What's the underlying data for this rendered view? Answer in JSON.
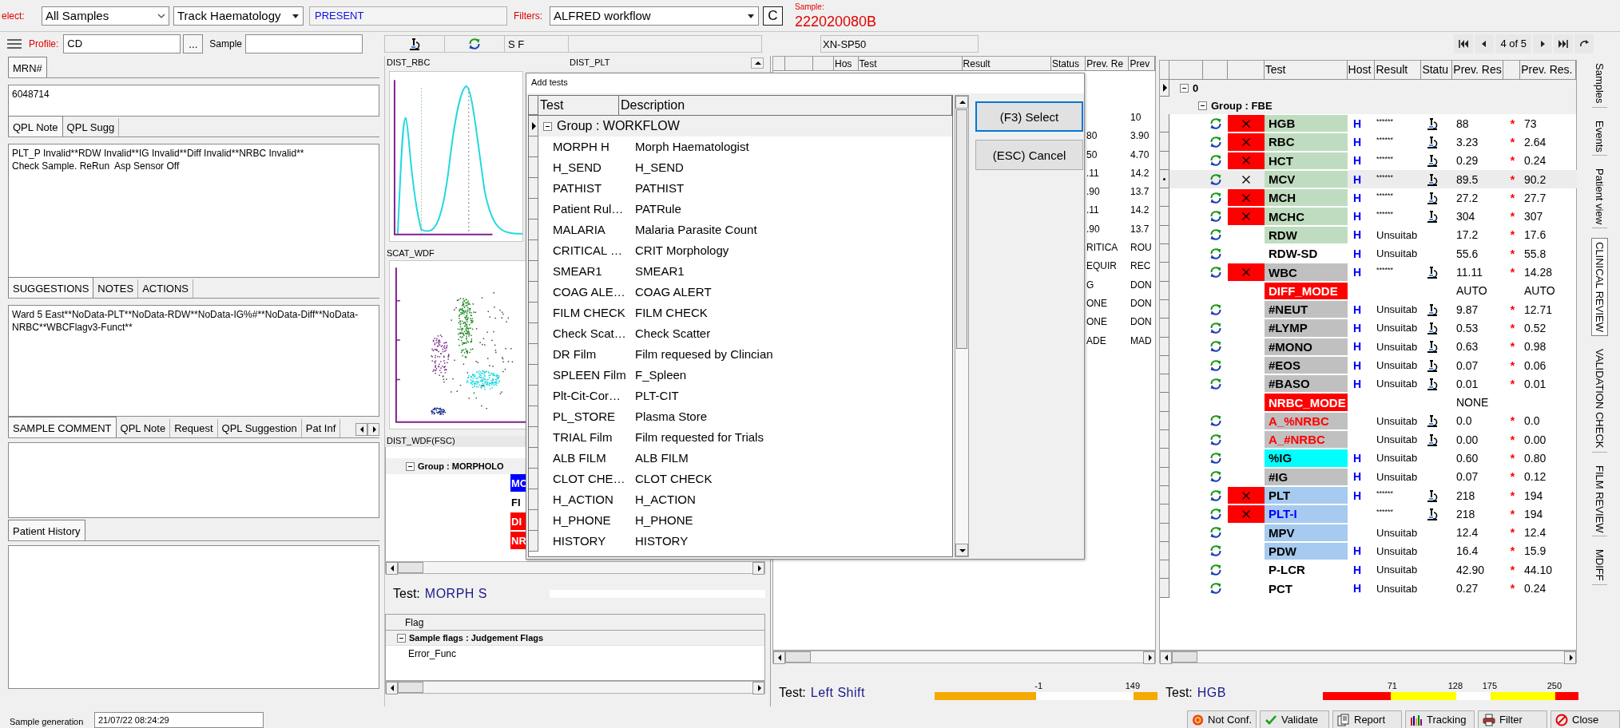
{
  "toolbar": {
    "select_label": "elect:",
    "sample_filter": "All Samples",
    "track": "Track Haematology",
    "status": "PRESENT",
    "filters_label": "Filters:",
    "workflow": "ALFRED workflow",
    "clear_button": "C",
    "sample_label": "Sample:",
    "sample_id": "222020080B"
  },
  "profile_bar": {
    "profile_label": "Profile:",
    "profile": "CD",
    "browse_button": "...",
    "sample_label": "Sample"
  },
  "instrument_bar": {
    "flags": "S F",
    "analyzer": "XN-SP50"
  },
  "navigator": {
    "position": "4 of 5"
  },
  "left_panel": {
    "mrn_tabs": [
      {
        "label": "MRN#",
        "selected": true
      }
    ],
    "mrn": "6048714",
    "note_tabs": [
      {
        "label": "QPL Note",
        "selected": true
      },
      {
        "label": "QPL Sugg",
        "selected": false
      }
    ],
    "note": "PLT_P Invalid**RDW Invalid**IG Invalid**Diff Invalid**NRBC Invalid**\nCheck Sample. ReRun  Asp Sensor Off",
    "suggestion_tabs": [
      {
        "label": "SUGGESTIONS",
        "selected": true
      },
      {
        "label": "NOTES",
        "selected": false
      },
      {
        "label": "ACTIONS",
        "selected": false
      }
    ],
    "suggestions": "Ward 5 East**NoData-PLT**NoData-RDW**NoData-IG%#**NoData-Diff**NoData-NRBC**WBCFlagv3-Funct**",
    "comment_tabs": [
      {
        "label": "SAMPLE COMMENT",
        "selected": true
      },
      {
        "label": "QPL Note",
        "selected": false
      },
      {
        "label": "Request",
        "selected": false
      },
      {
        "label": "QPL Suggestion",
        "selected": false
      },
      {
        "label": "Pat Inf",
        "selected": false
      }
    ],
    "history_tabs": [
      {
        "label": "Patient History",
        "selected": true
      }
    ],
    "sample_generation_label": "Sample generation",
    "sample_generation": "21/07/22 08:24:29"
  },
  "graphs": {
    "rbc_title": "DIST_RBC",
    "plt_title": "DIST_PLT",
    "wdf_title": "SCAT_WDF",
    "fsc_title": "DIST_WDF(FSC)"
  },
  "morphology_grid": {
    "group": "Group : MORPHOLO",
    "cells": [
      {
        "text": "MO",
        "color": "#0000ff"
      },
      {
        "text": "FI",
        "color": "#ffffff"
      },
      {
        "text": "DI",
        "color": "#ff0000"
      },
      {
        "text": "NR",
        "color": "#ff0000"
      }
    ]
  },
  "morph_test": {
    "label": "Test:",
    "name": "MORPH S"
  },
  "flag_grid": {
    "header": "Flag",
    "group": "Sample flags : Judgement Flags",
    "rows": [
      "Error_Func"
    ]
  },
  "results_grid": {
    "columns": [
      "Hos",
      "Test",
      "Result",
      "Status",
      "Prev. Re",
      "Prev"
    ],
    "rows": [
      {
        "prev_2": "10"
      },
      {
        "prev_1": "80",
        "prev_2": "3.90"
      },
      {
        "prev_1": "50",
        "prev_2": "4.70"
      },
      {
        "prev_1": ".11",
        "prev_2": "14.2"
      },
      {
        "prev_1": ".90",
        "prev_2": "13.7"
      },
      {
        "prev_1": ".11",
        "prev_2": "14.2"
      },
      {
        "prev_1": ".90",
        "prev_2": "13.7"
      },
      {
        "prev_1": "RITICA",
        "prev_2": "ROU"
      },
      {
        "prev_1": "EQUIR",
        "prev_2": "REC"
      },
      {
        "prev_1": "G",
        "prev_2": "DON"
      },
      {
        "prev_1": "ONE",
        "prev_2": "DON"
      },
      {
        "prev_1": "ONE",
        "prev_2": "DON"
      },
      {
        "prev_1": "ADE",
        "prev_2": "MAD"
      }
    ]
  },
  "left_shift": {
    "label": "Test:",
    "name": "Left Shift",
    "segments": [
      {
        "color": "#f4aa00",
        "tick": "-1"
      },
      {
        "color": "#ffffff",
        "tick": "149"
      },
      {
        "color": "#f4aa00"
      }
    ]
  },
  "dialog": {
    "title": "Add tests",
    "columns": [
      "Test",
      "Description"
    ],
    "group": "Group : WORKFLOW",
    "rows": [
      {
        "test": "MORPH H",
        "description": "Morph Haematologist"
      },
      {
        "test": "H_SEND",
        "description": "H_SEND"
      },
      {
        "test": "PATHIST",
        "description": "PATHIST"
      },
      {
        "test": "Patient Rul…",
        "description": "PATRule"
      },
      {
        "test": "MALARIA",
        "description": "Malaria Parasite Count"
      },
      {
        "test": "CRITICAL …",
        "description": "CRIT Morphology"
      },
      {
        "test": "SMEAR1",
        "description": "SMEAR1"
      },
      {
        "test": "COAG ALE…",
        "description": "COAG ALERT"
      },
      {
        "test": "FILM CHECK",
        "description": "FILM CHECK"
      },
      {
        "test": "Check Scat…",
        "description": "Check Scatter"
      },
      {
        "test": "DR Film",
        "description": "Film requesed by Clincian"
      },
      {
        "test": "SPLEEN Film",
        "description": "F_Spleen"
      },
      {
        "test": "Plt-Cit-Cor…",
        "description": "PLT-CIT"
      },
      {
        "test": "PL_STORE",
        "description": "Plasma Store"
      },
      {
        "test": "TRIAL Film",
        "description": "Film requested for Trials"
      },
      {
        "test": "ALB FILM",
        "description": "ALB FILM"
      },
      {
        "test": "CLOT CHE…",
        "description": "CLOT CHECK"
      },
      {
        "test": "H_ACTION",
        "description": "H_ACTION"
      },
      {
        "test": "H_PHONE",
        "description": "H_PHONE"
      },
      {
        "test": "HISTORY",
        "description": "HISTORY"
      }
    ],
    "buttons": [
      {
        "label": "(F3) Select",
        "default": true
      },
      {
        "label": "(ESC) Cancel",
        "default": false
      }
    ]
  },
  "review_grid": {
    "columns": [
      "Test",
      "Host",
      "Result",
      "Statu",
      "Prev. Res",
      "Prev. Res."
    ],
    "root": "0",
    "group": "Group : FBE",
    "rows": [
      {
        "test": "HGB",
        "kind": "normal",
        "color": "#c0dcc0",
        "refresh": true,
        "flagged": true,
        "host": "H",
        "result": "******",
        "status_icon": true,
        "prev_res": "88",
        "marker": "*",
        "prev_res_2": "73",
        "selected": false
      },
      {
        "test": "RBC",
        "kind": "normal",
        "color": "#c0dcc0",
        "refresh": true,
        "flagged": true,
        "host": "H",
        "result": "******",
        "status_icon": true,
        "prev_res": "3.23",
        "marker": "*",
        "prev_res_2": "2.64",
        "selected": false
      },
      {
        "test": "HCT",
        "kind": "normal",
        "color": "#c0dcc0",
        "refresh": true,
        "flagged": true,
        "host": "H",
        "result": "******",
        "status_icon": true,
        "prev_res": "0.29",
        "marker": "*",
        "prev_res_2": "0.24",
        "selected": false
      },
      {
        "test": "MCV",
        "kind": "normal",
        "color": "#c0dcc0",
        "refresh": true,
        "flagged": true,
        "host": "H",
        "result": "******",
        "status_icon": true,
        "prev_res": "89.5",
        "marker": "*",
        "prev_res_2": "90.2",
        "selected": true
      },
      {
        "test": "MCH",
        "kind": "normal",
        "color": "#c0dcc0",
        "refresh": true,
        "flagged": true,
        "host": "H",
        "result": "******",
        "status_icon": true,
        "prev_res": "27.2",
        "marker": "*",
        "prev_res_2": "27.7",
        "selected": false
      },
      {
        "test": "MCHC",
        "kind": "normal",
        "color": "#c0dcc0",
        "refresh": true,
        "flagged": true,
        "host": "H",
        "result": "******",
        "status_icon": true,
        "prev_res": "304",
        "marker": "*",
        "prev_res_2": "307",
        "selected": false
      },
      {
        "test": "RDW",
        "kind": "normal",
        "color": "#c0dcc0",
        "refresh": true,
        "flagged": false,
        "host": "H",
        "result": "Unsuitab",
        "status_icon": false,
        "prev_res": "17.2",
        "marker": "*",
        "prev_res_2": "17.6",
        "selected": false
      },
      {
        "test": "RDW-SD",
        "kind": "normal",
        "refresh": true,
        "flagged": false,
        "host": "H",
        "result": "Unsuitab",
        "status_icon": false,
        "prev_res": "55.6",
        "marker": "*",
        "prev_res_2": "55.8",
        "selected": false
      },
      {
        "test": "WBC",
        "kind": "normal",
        "color": "#c0c0c0",
        "refresh": true,
        "flagged": true,
        "host": "H",
        "result": "******",
        "status_icon": true,
        "prev_res": "11.11",
        "marker": "*",
        "prev_res_2": "14.28",
        "selected": false
      },
      {
        "test": "DIFF_MODE",
        "kind": "mode",
        "color": "#ff0000",
        "refresh": false,
        "flagged": false,
        "status_icon": false,
        "prev_res": "AUTO",
        "prev_res_2": "AUTO",
        "selected": false
      },
      {
        "test": "#NEUT",
        "kind": "normal",
        "color": "#c0c0c0",
        "refresh": true,
        "flagged": false,
        "host": "H",
        "result": "Unsuitab",
        "status_icon": true,
        "prev_res": "9.87",
        "marker": "*",
        "prev_res_2": "12.71",
        "selected": false
      },
      {
        "test": "#LYMP",
        "kind": "normal",
        "color": "#c0c0c0",
        "refresh": true,
        "flagged": false,
        "host": "H",
        "result": "Unsuitab",
        "status_icon": true,
        "prev_res": "0.53",
        "marker": "*",
        "prev_res_2": "0.52",
        "selected": false
      },
      {
        "test": "#MONO",
        "kind": "normal",
        "color": "#c0c0c0",
        "refresh": true,
        "flagged": false,
        "host": "H",
        "result": "Unsuitab",
        "status_icon": true,
        "prev_res": "0.63",
        "marker": "*",
        "prev_res_2": "0.98",
        "selected": false
      },
      {
        "test": "#EOS",
        "kind": "normal",
        "color": "#c0c0c0",
        "refresh": true,
        "flagged": false,
        "host": "H",
        "result": "Unsuitab",
        "status_icon": true,
        "prev_res": "0.07",
        "marker": "*",
        "prev_res_2": "0.06",
        "selected": false
      },
      {
        "test": "#BASO",
        "kind": "normal",
        "color": "#c0c0c0",
        "refresh": true,
        "flagged": false,
        "host": "H",
        "result": "Unsuitab",
        "status_icon": true,
        "prev_res": "0.01",
        "marker": "*",
        "prev_res_2": "0.01",
        "selected": false
      },
      {
        "test": "NRBC_MODE",
        "kind": "mode",
        "color": "#ff0000",
        "refresh": false,
        "flagged": false,
        "status_icon": false,
        "prev_res": "NONE",
        "selected": false
      },
      {
        "test": "A_%NRBC",
        "kind": "alert",
        "color": "#c0c0c0",
        "refresh": true,
        "flagged": false,
        "result": "Unsuitab",
        "status_icon": true,
        "prev_res": "0.0",
        "marker": "*",
        "prev_res_2": "0.0",
        "selected": false
      },
      {
        "test": "A_#NRBC",
        "kind": "alert",
        "color": "#c0c0c0",
        "refresh": true,
        "flagged": false,
        "result": "Unsuitab",
        "status_icon": true,
        "prev_res": "0.00",
        "marker": "*",
        "prev_res_2": "0.00",
        "selected": false
      },
      {
        "test": "%IG",
        "kind": "normal",
        "color": "#00ffff",
        "refresh": true,
        "flagged": false,
        "host": "H",
        "result": "Unsuitab",
        "status_icon": false,
        "prev_res": "0.60",
        "marker": "*",
        "prev_res_2": "0.80",
        "selected": false
      },
      {
        "test": "#IG",
        "kind": "normal",
        "color": "#c0c0c0",
        "refresh": true,
        "flagged": false,
        "host": "H",
        "result": "Unsuitab",
        "status_icon": false,
        "prev_res": "0.07",
        "marker": "*",
        "prev_res_2": "0.12",
        "selected": false
      },
      {
        "test": "PLT",
        "kind": "normal",
        "color": "#a6caf0",
        "refresh": true,
        "flagged": true,
        "host": "H",
        "result": "******",
        "status_icon": true,
        "prev_res": "218",
        "marker": "*",
        "prev_res_2": "194",
        "selected": false
      },
      {
        "test": "PLT-I",
        "kind": "linked",
        "color": "#a6caf0",
        "refresh": true,
        "flagged": true,
        "result": "******",
        "status_icon": true,
        "prev_res": "218",
        "marker": "*",
        "prev_res_2": "194",
        "selected": false
      },
      {
        "test": "MPV",
        "kind": "normal",
        "color": "#a6caf0",
        "refresh": true,
        "flagged": false,
        "result": "Unsuitab",
        "status_icon": false,
        "prev_res": "12.4",
        "marker": "*",
        "prev_res_2": "12.4",
        "selected": false
      },
      {
        "test": "PDW",
        "kind": "normal",
        "color": "#a6caf0",
        "refresh": true,
        "flagged": false,
        "host": "H",
        "result": "Unsuitab",
        "status_icon": false,
        "prev_res": "16.4",
        "marker": "*",
        "prev_res_2": "15.9",
        "selected": false
      },
      {
        "test": "P-LCR",
        "kind": "normal",
        "refresh": true,
        "flagged": false,
        "host": "H",
        "result": "Unsuitab",
        "status_icon": false,
        "prev_res": "42.90",
        "marker": "*",
        "prev_res_2": "44.10",
        "selected": false
      },
      {
        "test": "PCT",
        "kind": "normal",
        "refresh": true,
        "flagged": false,
        "host": "H",
        "result": "Unsuitab",
        "status_icon": false,
        "prev_res": "0.27",
        "marker": "*",
        "prev_res_2": "0.24",
        "selected": false
      }
    ]
  },
  "hgb_range": {
    "label": "Test:",
    "name": "HGB",
    "segments": [
      {
        "color": "#ff0000",
        "tick": "71"
      },
      {
        "color": "#ffff00",
        "tick": "128"
      },
      {
        "color": "#ffffff",
        "tick": "175"
      },
      {
        "color": "#ffff00",
        "tick": "250"
      },
      {
        "color": "#ff0000"
      }
    ]
  },
  "side_tabs": [
    {
      "label": "Samples",
      "selected": false
    },
    {
      "label": "Events",
      "selected": false
    },
    {
      "label": "Patient view",
      "selected": false
    },
    {
      "label": "CLINICAL REVIEW",
      "selected": true
    },
    {
      "label": "VALIDATION CHECK",
      "selected": false
    },
    {
      "label": "FILM REVIEW",
      "selected": false
    },
    {
      "label": "MDIFF",
      "selected": false
    }
  ],
  "actions": [
    {
      "label": "Not Conf.",
      "kind": "target"
    },
    {
      "label": "Validate",
      "kind": "check"
    },
    {
      "label": "Report",
      "kind": "report"
    },
    {
      "label": "Tracking",
      "kind": "tracking"
    },
    {
      "label": "Filter",
      "kind": "filter"
    },
    {
      "label": "Close",
      "kind": "close"
    }
  ]
}
